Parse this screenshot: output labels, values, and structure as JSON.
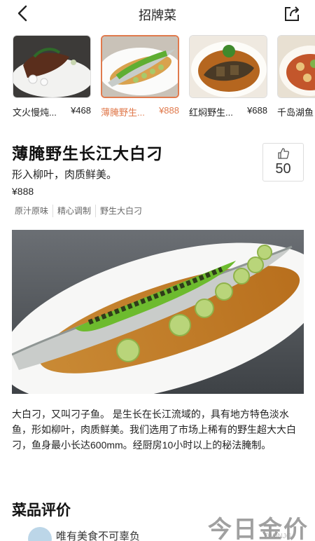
{
  "nav": {
    "title": "招牌菜"
  },
  "dishes": [
    {
      "name": "文火慢炖...",
      "price": "¥468",
      "active": false
    },
    {
      "name": "薄腌野生...",
      "price": "¥888",
      "active": true
    },
    {
      "name": "红焖野生...",
      "price": "¥688",
      "active": false
    },
    {
      "name": "千岛湖鱼",
      "price": "",
      "active": false
    }
  ],
  "detail": {
    "title": "薄腌野生长江大白刁",
    "subtitle": "形入柳叶，肉质鲜美。",
    "price": "¥888",
    "likes": "50",
    "tags": [
      "原汁原味",
      "精心调制",
      "野生大白刁"
    ],
    "description": "大白刁，又叫刁子鱼。 是生长在长江流域的，具有地方特色淡水鱼，形如柳叶，肉质鲜美。我们选用了市场上稀有的野生超大大白刁，鱼身最小长达600mm。经厨房10小时以上的秘法腌制。"
  },
  "reviews": {
    "title": "菜品评价",
    "first_reviewer": "唯有美食不可辜负"
  },
  "watermark": {
    "text": "今日金价",
    "sub": "TWJNJG"
  },
  "colors": {
    "accent": "#e07a4d",
    "text": "#222222",
    "muted": "#666666"
  }
}
